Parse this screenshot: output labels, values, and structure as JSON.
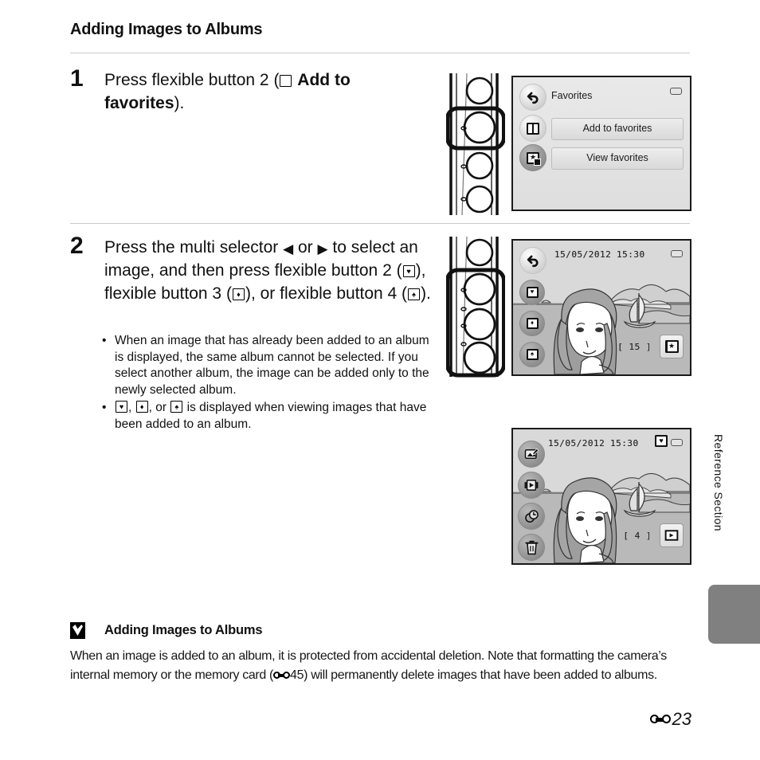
{
  "page": {
    "section_title": "Adding Images to Albums",
    "side_label": "Reference Section",
    "page_number": "23",
    "page_number_icon": "reference-section-icon"
  },
  "steps": [
    {
      "number": "1",
      "text_before": "Press flexible button 2 (",
      "icon": "album-plain-icon",
      "bold_text": "Add to favorites",
      "text_after": ")."
    },
    {
      "number": "2",
      "line1_a": "Press the multi selector ",
      "left_arrow": "◀",
      "line1_b": " or ",
      "right_arrow": "▶",
      "line1_c": " to",
      "line2": "select an image, and then press",
      "line3_a": "flexible button 2 (",
      "icon_heart": "album-heart-icon",
      "line3_b": "), flexible button 3",
      "line4_a": "(",
      "icon_diamond": "album-diamond-icon",
      "line4_b": "), or flexible button 4 (",
      "icon_spade": "album-spade-icon",
      "line4_c": ")."
    }
  ],
  "bullets": [
    "When an image that has already been added to an album is displayed, the same album cannot be selected. If you select another album, the image can be added only to the newly selected album.",
    {
      "prefix": "",
      "middle": ", ",
      "middle2": ", or ",
      "suffix": " is displayed when viewing images that have been added to an album."
    }
  ],
  "screen_menu": {
    "title": "Favorites",
    "back_icon": "back-arrow-icon",
    "battery_icon": "battery-icon",
    "items": [
      {
        "label": "Add to favorites",
        "icon": "album-plain-icon"
      },
      {
        "label": "View favorites",
        "icon": "album-star-icon"
      }
    ]
  },
  "screen_select": {
    "date": "15/05/2012",
    "time": "15:30",
    "battery_icon": "battery-icon",
    "back_icon": "back-arrow-icon",
    "counter": "[   15 ]",
    "corner_button_icon": "album-star-icon",
    "side_icons": [
      "album-heart-icon",
      "album-diamond-icon",
      "album-spade-icon"
    ]
  },
  "screen_playback": {
    "date": "15/05/2012",
    "time": "15:30",
    "badge_icon": "album-heart-icon",
    "battery_icon": "battery-icon",
    "counter": "[    4 ]",
    "corner_button_icon": "playback-icon",
    "side_icons": [
      "retouch-icon",
      "slideshow-icon",
      "print-order-icon",
      "delete-icon"
    ]
  },
  "camera_illustrations": [
    {
      "name": "camera-buttons-step1",
      "highlighted_buttons": [
        2
      ]
    },
    {
      "name": "camera-buttons-step2",
      "highlighted_buttons": [
        2,
        3,
        4
      ]
    }
  ],
  "note": {
    "icon": "caution-checkmark-icon",
    "title": "Adding Images to Albums",
    "body_a": "When an image is added to an album, it is protected from accidental deletion. Note that formatting the camera’s internal memory or the memory card (",
    "ref_icon": "reference-section-icon",
    "body_ref": "45",
    "body_b": ") will permanently delete images that have been added to albums."
  }
}
